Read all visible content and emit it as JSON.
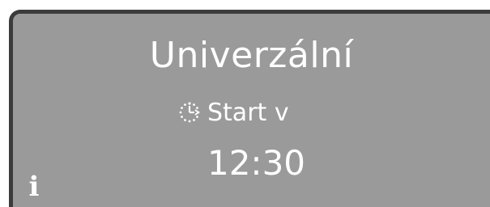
{
  "display": {
    "program_name": "Univerzální",
    "start_label": "Start v",
    "start_time": "12:30",
    "info_glyph": "i"
  },
  "icons": {
    "timer": "delay-start-clock-icon",
    "info": "info-icon"
  },
  "colors": {
    "screen_background": "#9a9a9a",
    "screen_border": "#3c3c3c",
    "text": "#ffffff"
  }
}
